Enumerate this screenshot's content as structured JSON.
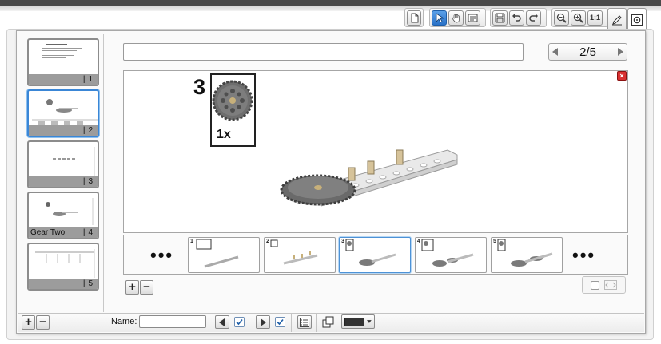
{
  "toolbar": {
    "groups": [
      {
        "buttons": [
          {
            "icon": "new-page-icon"
          }
        ]
      },
      {
        "buttons": [
          {
            "icon": "pointer-icon",
            "active": true
          },
          {
            "icon": "hand-icon"
          },
          {
            "icon": "text-box-icon"
          }
        ]
      },
      {
        "buttons": [
          {
            "icon": "save-icon"
          },
          {
            "icon": "undo-icon"
          },
          {
            "icon": "redo-icon"
          }
        ]
      },
      {
        "buttons": [
          {
            "icon": "zoom-out-icon"
          },
          {
            "icon": "zoom-in-icon"
          },
          {
            "icon": "actual-size-icon",
            "label": "1:1"
          }
        ]
      }
    ],
    "tabs": [
      {
        "icon": "edit-pencil-icon"
      },
      {
        "icon": "settings-icon",
        "selected": true
      }
    ]
  },
  "thumbnails": [
    {
      "label": "",
      "number": "1"
    },
    {
      "label": "",
      "number": "2",
      "selected": true
    },
    {
      "label": "",
      "number": "3"
    },
    {
      "label": "Gear Two",
      "number": "4"
    },
    {
      "label": "",
      "number": "5"
    }
  ],
  "page_name": {
    "value": ""
  },
  "pager": {
    "value": "2/5"
  },
  "step": {
    "number": "3",
    "callout_qty": "1x"
  },
  "filmstrip": {
    "more_left": "•••",
    "more_right": "•••",
    "frames": [
      {
        "number": "1"
      },
      {
        "number": "2"
      },
      {
        "number": "3",
        "selected": true
      },
      {
        "number": "4"
      },
      {
        "number": "5"
      }
    ]
  },
  "bottom": {
    "name_label": "Name:",
    "name_value": "",
    "color_value": "#333333"
  },
  "colors": {
    "accent": "#3a86d6",
    "close": "#d83030"
  }
}
